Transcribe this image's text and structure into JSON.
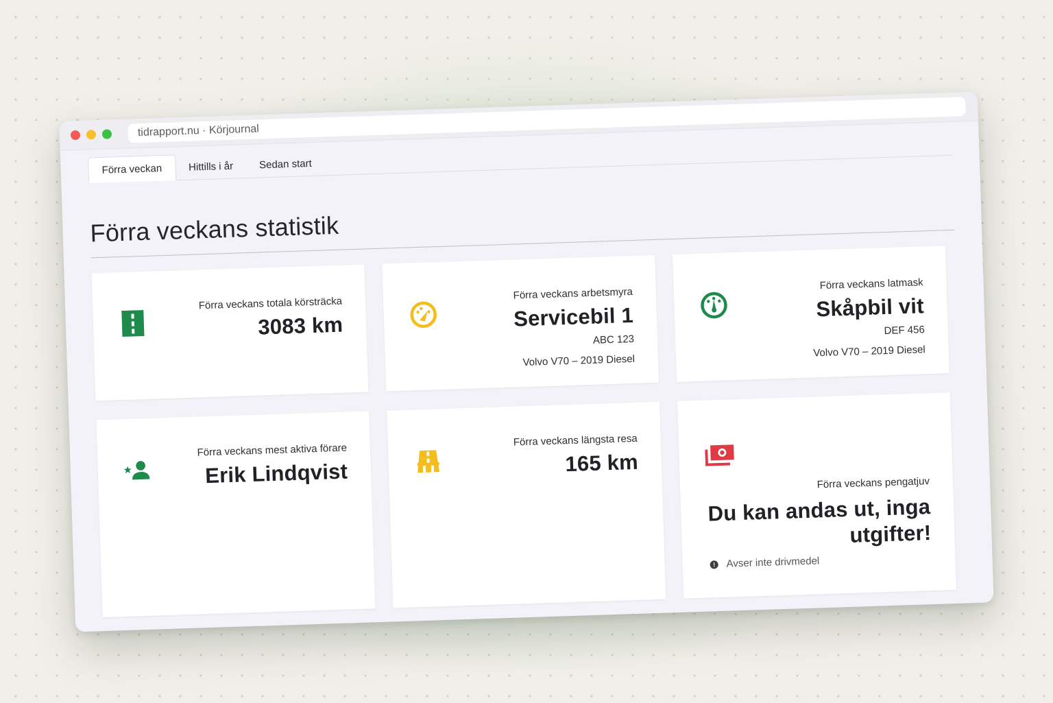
{
  "browser": {
    "url_text": "tidrapport.nu · Körjournal"
  },
  "tabs": [
    {
      "label": "Förra veckan",
      "active": true
    },
    {
      "label": "Hittills i år",
      "active": false
    },
    {
      "label": "Sedan start",
      "active": false
    }
  ],
  "page": {
    "title": "Förra veckans statistik"
  },
  "cards": {
    "distance": {
      "label": "Förra veckans totala körsträcka",
      "value": "3083 km",
      "icon": "road-icon"
    },
    "hardest_worker": {
      "label": "Förra veckans arbetsmyra",
      "value": "Servicebil 1",
      "plate": "ABC 123",
      "model": "Volvo V70 – 2019 Diesel",
      "icon": "speedometer-fast-icon"
    },
    "laziest": {
      "label": "Förra veckans latmask",
      "value": "Skåpbil vit",
      "plate": "DEF 456",
      "model": "Volvo V70 – 2019 Diesel",
      "icon": "speedometer-slow-icon"
    },
    "active_driver": {
      "label": "Förra veckans mest aktiva förare",
      "value": "Erik Lindqvist",
      "icon": "person-star-icon"
    },
    "longest_trip": {
      "label": "Förra veckans längsta resa",
      "value": "165 km",
      "icon": "highway-icon"
    },
    "money_thief": {
      "label": "Förra veckans pengatjuv",
      "value": "Du kan andas ut, inga utgifter!",
      "note": "Avser inte drivmedel",
      "icon": "money-icon"
    }
  },
  "colors": {
    "green": "#1e8a4c",
    "yellow": "#f5bd1c",
    "red": "#de3b45",
    "background_glow": "#7fb87f"
  }
}
